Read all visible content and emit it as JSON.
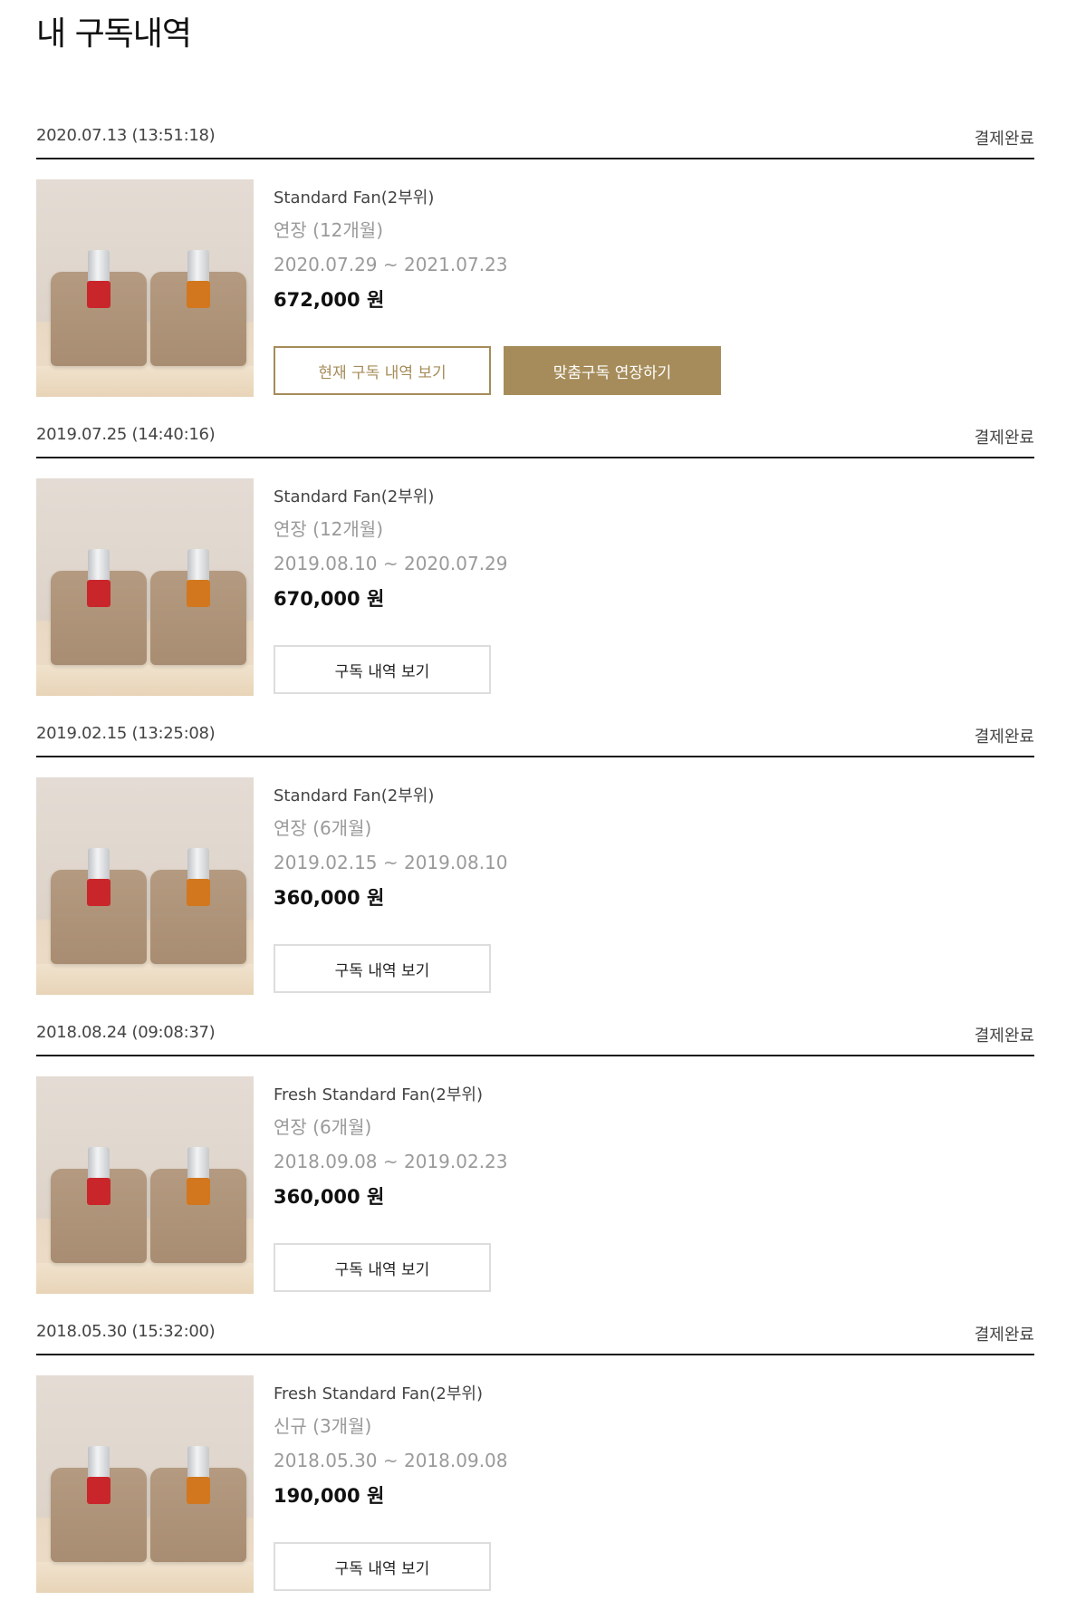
{
  "page": {
    "title": "내 구독내역"
  },
  "orders": [
    {
      "date": "2020.07.13 (13:51:18)",
      "status": "결제완료",
      "product": "Standard Fan(2부위)",
      "plan": "연장 (12개월)",
      "period": "2020.07.29 ~ 2021.07.23",
      "price": "672,000 원",
      "buttons": [
        "현재 구독 내역 보기",
        "맞춤구독 연장하기"
      ]
    },
    {
      "date": "2019.07.25 (14:40:16)",
      "status": "결제완료",
      "product": "Standard Fan(2부위)",
      "plan": "연장 (12개월)",
      "period": "2019.08.10 ~ 2020.07.29",
      "price": "670,000 원",
      "buttons": [
        "구독 내역 보기"
      ]
    },
    {
      "date": "2019.02.15 (13:25:08)",
      "status": "결제완료",
      "product": "Standard Fan(2부위)",
      "plan": "연장 (6개월)",
      "period": "2019.02.15 ~ 2019.08.10",
      "price": "360,000 원",
      "buttons": [
        "구독 내역 보기"
      ]
    },
    {
      "date": "2018.08.24 (09:08:37)",
      "status": "결제완료",
      "product": "Fresh Standard Fan(2부위)",
      "plan": "연장 (6개월)",
      "period": "2018.09.08 ~ 2019.02.23",
      "price": "360,000 원",
      "buttons": [
        "구독 내역 보기"
      ]
    },
    {
      "date": "2018.05.30 (15:32:00)",
      "status": "결제완료",
      "product": "Fresh Standard Fan(2부위)",
      "plan": "신규 (3개월)",
      "period": "2018.05.30 ~ 2018.09.08",
      "price": "190,000 원",
      "buttons": [
        "구독 내역 보기"
      ]
    }
  ],
  "colors": {
    "accent_gold": "#a68c5a",
    "muted_text": "#9a9a9a",
    "divider": "#1a1a1a"
  },
  "icons": {
    "product_thumbnail": "product-pouch-photo"
  }
}
